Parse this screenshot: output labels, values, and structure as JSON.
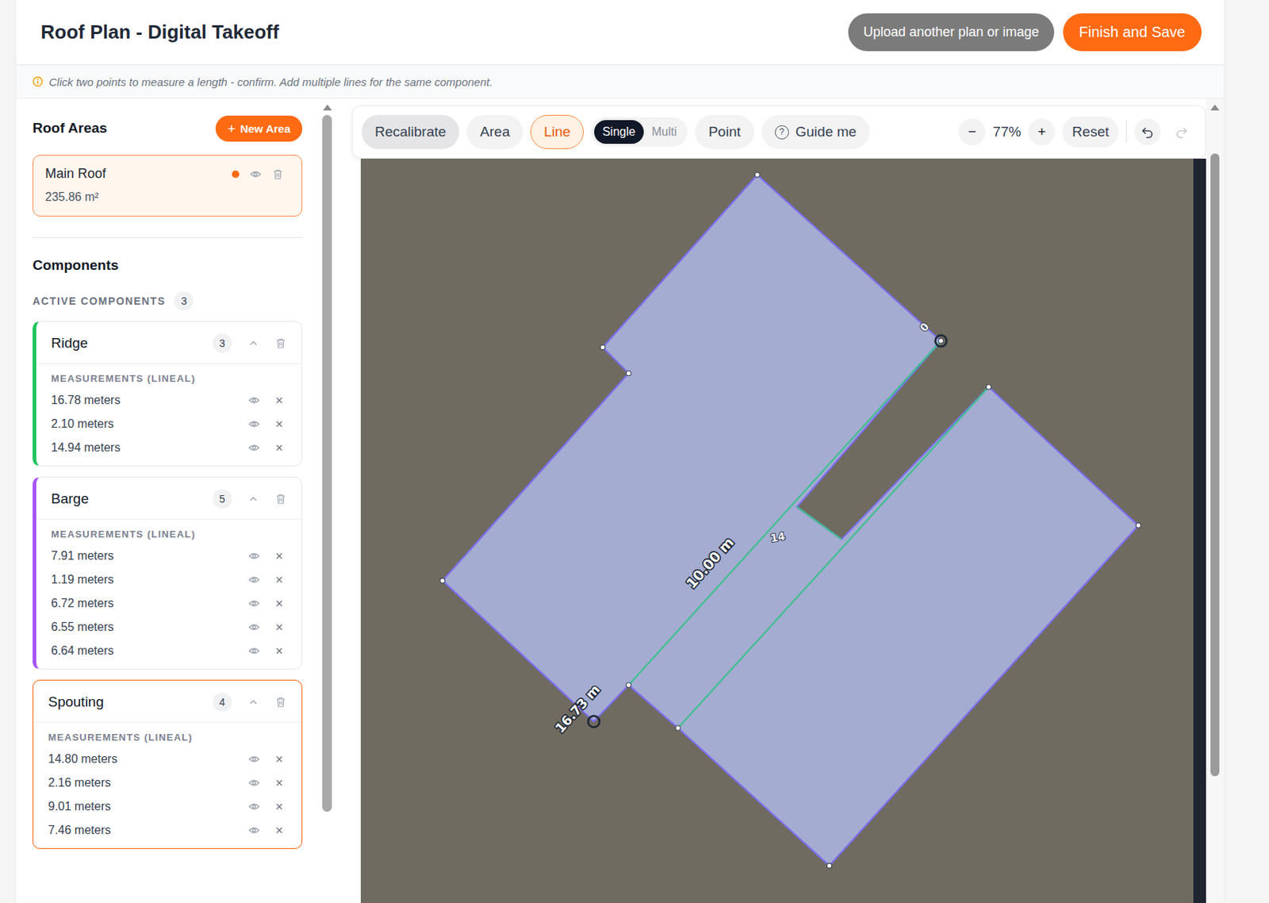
{
  "header": {
    "title": "Roof Plan - Digital Takeoff",
    "buttons": [
      {
        "label": "Upload another plan or image",
        "kind": "secondary"
      },
      {
        "label": "Finish and Save",
        "kind": "primary"
      }
    ]
  },
  "hint": "Click two points to measure a length - confirm. Add multiple lines for the same component.",
  "roof_areas": {
    "title": "Roof Areas",
    "new_button": {
      "icon": "+",
      "label": "New Area"
    },
    "items": [
      {
        "name": "Main Roof",
        "area": "235.86 m²",
        "selected": true,
        "color": "#ff6a13"
      }
    ]
  },
  "components": {
    "title": "Components",
    "active_label": "ACTIVE COMPONENTS",
    "active_count": "3",
    "items": [
      {
        "name": "Ridge",
        "count": "3",
        "color": "#22c55e",
        "selected": false,
        "expanded": true,
        "measurements_label": "MEASUREMENTS (LINEAL)",
        "measurements": [
          "16.78 meters",
          "2.10 meters",
          "14.94 meters"
        ]
      },
      {
        "name": "Barge",
        "count": "5",
        "color": "#a855f7",
        "selected": false,
        "expanded": true,
        "measurements_label": "MEASUREMENTS (LINEAL)",
        "measurements": [
          "7.91 meters",
          "1.19 meters",
          "6.72 meters",
          "6.55 meters",
          "6.64 meters"
        ]
      },
      {
        "name": "Spouting",
        "count": "4",
        "color": "#ff6a13",
        "selected": true,
        "expanded": true,
        "measurements_label": "MEASUREMENTS (LINEAL)",
        "measurements": [
          "14.80 meters",
          "2.16 meters",
          "9.01 meters",
          "7.46 meters"
        ]
      }
    ]
  },
  "toolbar": {
    "recalibrate": "Recalibrate",
    "tools": [
      {
        "label": "Area",
        "selected": false
      },
      {
        "label": "Line",
        "selected": true
      }
    ],
    "modes": [
      {
        "label": "Single",
        "selected": true
      },
      {
        "label": "Multi",
        "selected": false
      }
    ],
    "point": {
      "label": "Point",
      "selected": false
    },
    "guide": {
      "icon": "?",
      "label": "Guide me"
    },
    "zoom": {
      "out": "−",
      "level": "77%",
      "in": "+",
      "reset": "Reset"
    },
    "history": [
      {
        "kind": "undo",
        "disabled": false
      },
      {
        "kind": "redo",
        "disabled": true
      }
    ]
  },
  "map": {
    "labels": [
      {
        "text": "10.00 m"
      },
      {
        "text": "14"
      },
      {
        "text": "16.73 m"
      },
      {
        "text": "0"
      }
    ]
  }
}
